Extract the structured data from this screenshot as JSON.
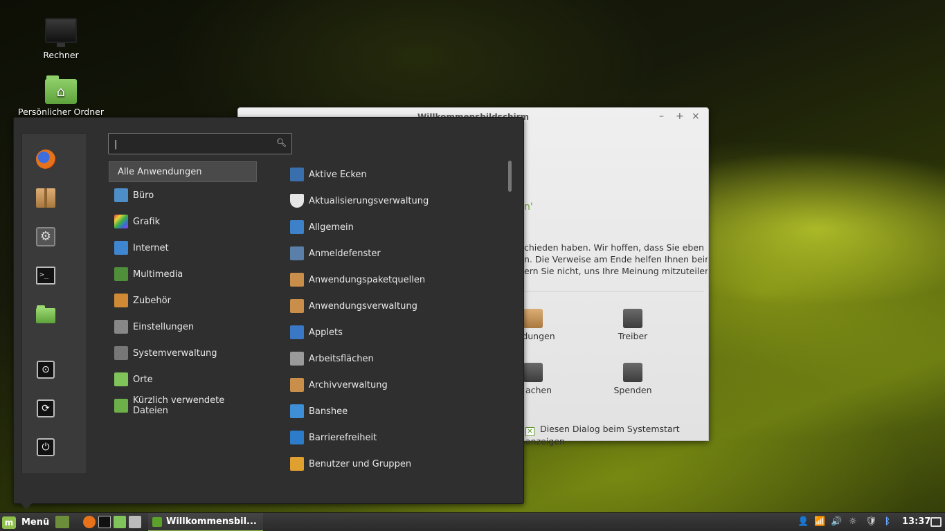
{
  "desktop": {
    "icons": [
      {
        "label": "Rechner"
      },
      {
        "label": "Persönlicher Ordner"
      }
    ]
  },
  "welcome_window": {
    "title": "Willkommensbildschirm",
    "accent_text": "n'",
    "body_lines": [
      "chieden haben. Wir hoffen, dass Sie eben",
      "n. Die Verweise am Ende helfen Ihnen beim",
      "ern Sie nicht, uns Ihre Meinung mitzuteilen."
    ],
    "tiles": [
      {
        "label": "dungen"
      },
      {
        "label": "Treiber"
      },
      {
        "label": "achen"
      },
      {
        "label": "Spenden"
      }
    ],
    "startup_checkbox_label": "Diesen Dialog beim Systemstart anzeigen",
    "controls": {
      "minimize": "–",
      "maximize": "+",
      "close": "×"
    }
  },
  "menu": {
    "search": {
      "value": "",
      "cursor": "|",
      "icon": "search-icon"
    },
    "favorites": [
      {
        "name": "firefox-icon"
      },
      {
        "name": "software-manager-icon"
      },
      {
        "name": "system-settings-icon"
      },
      {
        "name": "terminal-icon"
      },
      {
        "name": "files-folder-icon"
      }
    ],
    "session_buttons": [
      {
        "name": "lock-screen-icon",
        "glyph": "⊙"
      },
      {
        "name": "logout-icon",
        "glyph": "⟳"
      },
      {
        "name": "power-off-icon",
        "glyph": "⏻"
      }
    ],
    "categories": [
      {
        "label": "Alle Anwendungen",
        "active": true,
        "color": ""
      },
      {
        "label": "Büro",
        "color": "#4d8ec8"
      },
      {
        "label": "Grafik",
        "color": "#d9488a"
      },
      {
        "label": "Internet",
        "color": "#3f86d1"
      },
      {
        "label": "Multimedia",
        "color": "#4f8f3a"
      },
      {
        "label": "Zubehör",
        "color": "#d08a36"
      },
      {
        "label": "Einstellungen",
        "color": "#888888"
      },
      {
        "label": "Systemverwaltung",
        "color": "#777777"
      },
      {
        "label": "Orte",
        "color": "#7fc35a"
      },
      {
        "label": "Kürzlich verwendete Dateien",
        "color": "#6db04a"
      }
    ],
    "applications": [
      {
        "label": "Aktive Ecken",
        "color": "#3a6fae"
      },
      {
        "label": "Aktualisierungsverwaltung",
        "color": "#e6e6e6"
      },
      {
        "label": "Allgemein",
        "color": "#3d82c8"
      },
      {
        "label": "Anmeldefenster",
        "color": "#5a7fa8"
      },
      {
        "label": "Anwendungspaketquellen",
        "color": "#c98f4a"
      },
      {
        "label": "Anwendungsverwaltung",
        "color": "#c98f4a"
      },
      {
        "label": "Applets",
        "color": "#3a78c6"
      },
      {
        "label": "Arbeitsflächen",
        "color": "#9a9a9a"
      },
      {
        "label": "Archivverwaltung",
        "color": "#c98f4a"
      },
      {
        "label": "Banshee",
        "color": "#3f8fd8"
      },
      {
        "label": "Barrierefreiheit",
        "color": "#2d7cc9"
      },
      {
        "label": "Benutzer und Gruppen",
        "color": "#e0a030"
      }
    ]
  },
  "panel": {
    "menu_label": "Menü",
    "launchers": [
      {
        "name": "show-desktop-icon",
        "color": "#6c8d3a"
      },
      {
        "name": "firefox-launcher-icon",
        "color": "#e8721a"
      },
      {
        "name": "terminal-launcher-icon",
        "color": "#111111"
      },
      {
        "name": "files-launcher-icon",
        "color": "#7fc35a"
      },
      {
        "name": "calculator-launcher-icon",
        "color": "#bbbbbb"
      }
    ],
    "task_label": "Willkommensbil...",
    "tray": [
      {
        "name": "user-icon",
        "glyph": "👤"
      },
      {
        "name": "wifi-icon",
        "glyph": "📶"
      },
      {
        "name": "volume-icon",
        "glyph": "🔊"
      },
      {
        "name": "brightness-icon",
        "glyph": "☼"
      },
      {
        "name": "update-shield-icon",
        "glyph": "🛡"
      },
      {
        "name": "bluetooth-icon",
        "glyph": "ᛒ"
      }
    ],
    "clock": "13:37"
  }
}
